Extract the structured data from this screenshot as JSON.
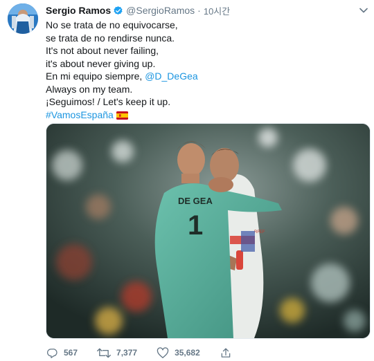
{
  "tweet": {
    "author_name": "Sergio Ramos",
    "handle": "@SergioRamos",
    "separator": "·",
    "time": "10시간",
    "lines": [
      "No se trata de no equivocarse,",
      "se trata de no rendirse nunca.",
      "It's not about never failing,",
      "it's about never giving up.",
      "Always on my team.",
      "¡Seguimos! / Let's keep it up."
    ],
    "mention_prefix": "En mi equipo siempre, ",
    "mention": "@D_DeGea",
    "hashtag": "#VamosEspaña",
    "image": {
      "jersey_text": "DE GEA",
      "jersey_number": "1",
      "sleeve_patch": "RFEF"
    },
    "actions": {
      "replies": "567",
      "retweets": "7,377",
      "likes": "35,682"
    },
    "colors": {
      "link": "#1b95e0",
      "verified": "#1da1f2",
      "text_secondary": "#657786",
      "jersey": "#4fa997"
    },
    "icons": [
      "verified-badge-icon",
      "chevron-down-icon",
      "reply-icon",
      "retweet-icon",
      "heart-icon",
      "share-icon",
      "spain-flag-icon"
    ]
  }
}
